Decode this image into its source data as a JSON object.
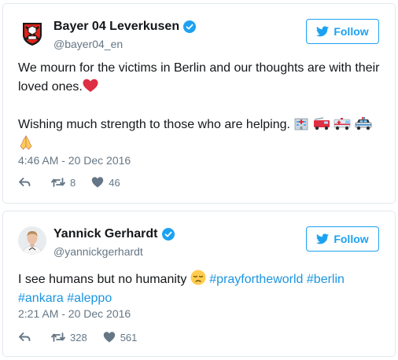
{
  "colors": {
    "accent": "#1da1f2",
    "hashtag": "#1b95e0",
    "muted": "#657786",
    "heart": "#e0245e",
    "border": "#e1e8ed"
  },
  "tweets": [
    {
      "display_name": "Bayer 04 Leverkusen",
      "handle": "@bayer04_en",
      "verified_icon": "verified-badge-icon",
      "follow_label": "Follow",
      "text_line1": "We mourn for the victims in Berlin and our thoughts are with their loved ones.",
      "text_line1_emoji": "red-heart",
      "text_line2": "Wishing much strength to those who are helping.",
      "text_line2_emojis": [
        "hospital",
        "fire-engine",
        "ambulance",
        "police-car",
        "folded-hands"
      ],
      "timestamp": "4:46 AM - 20 Dec 2016",
      "retweets": "8",
      "likes": "46"
    },
    {
      "display_name": "Yannick Gerhardt",
      "handle": "@yannickgerhardt",
      "verified_icon": "verified-badge-icon",
      "follow_label": "Follow",
      "text_plain": "I see humans but no humanity",
      "text_emoji": "pensive-face",
      "hashtags_line1": [
        "#prayfortheworld",
        "#berlin"
      ],
      "hashtags_line2": [
        "#ankara",
        "#aleppo"
      ],
      "timestamp": "2:21 AM - 20 Dec 2016",
      "retweets": "328",
      "likes": "561"
    }
  ]
}
